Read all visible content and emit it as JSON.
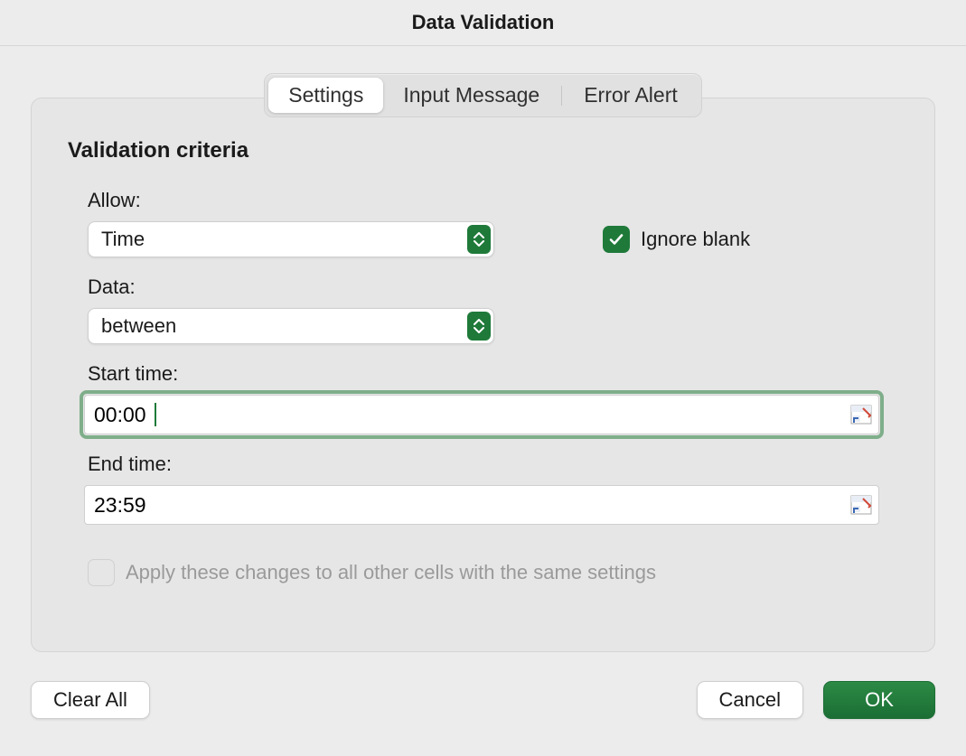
{
  "dialog": {
    "title": "Data Validation"
  },
  "tabs": {
    "settings": "Settings",
    "input_message": "Input Message",
    "error_alert": "Error Alert"
  },
  "section": {
    "title": "Validation criteria"
  },
  "allow": {
    "label": "Allow:",
    "value": "Time"
  },
  "ignore_blank": {
    "label": "Ignore blank",
    "checked": true
  },
  "data_crit": {
    "label": "Data:",
    "value": "between"
  },
  "start_time": {
    "label": "Start time:",
    "value": "00:00"
  },
  "end_time": {
    "label": "End time:",
    "value": "23:59"
  },
  "apply_all": {
    "label": "Apply these changes to all other cells with the same settings",
    "checked": false
  },
  "buttons": {
    "clear_all": "Clear All",
    "cancel": "Cancel",
    "ok": "OK"
  }
}
